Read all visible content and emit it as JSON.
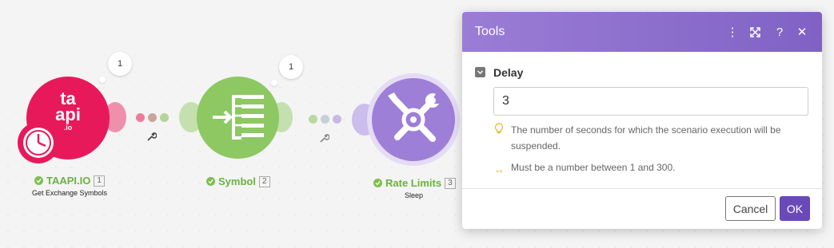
{
  "colors": {
    "taapi": "#e8195b",
    "symbol": "#8dc863",
    "rate_limits": "#9d7fd8",
    "header": "#8e71cf",
    "ok": "#6a49b8"
  },
  "modules": [
    {
      "name": "TAAPI.IO",
      "number": "1",
      "subtitle": "Get Exchange Symbols",
      "bubble": "1",
      "logo_text_top": "ta",
      "logo_text_mid": "api",
      "logo_text_bot": ".io"
    },
    {
      "name": "Symbol",
      "number": "2",
      "subtitle": "",
      "bubble": "1"
    },
    {
      "name": "Rate Limits",
      "number": "3",
      "subtitle": "Sleep",
      "bubble": ""
    }
  ],
  "dialog": {
    "title": "Tools",
    "field_label": "Delay",
    "field_value": "3",
    "hint_text": "The number of seconds for which the scenario execution will be suspended.",
    "range_text": "Must be a number between 1 and 300.",
    "cancel_label": "Cancel",
    "ok_label": "OK"
  }
}
